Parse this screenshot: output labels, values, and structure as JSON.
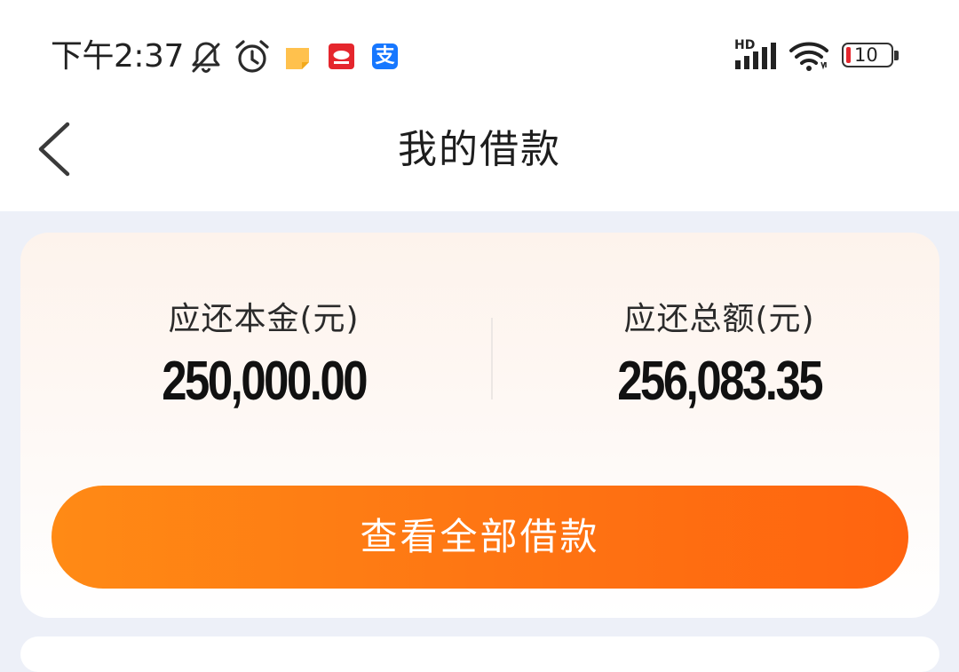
{
  "status_bar": {
    "time": "下午2:37",
    "hd_label": "HD",
    "battery_level": "10",
    "alipay_glyph": "支",
    "icons": [
      "bell-off-icon",
      "alarm-icon",
      "notes-app-icon",
      "red-app-icon",
      "alipay-icon",
      "signal-icon",
      "wifi-icon",
      "battery-icon"
    ]
  },
  "nav": {
    "title": "我的借款",
    "back_icon": "chevron-left-icon"
  },
  "summary": {
    "principal_label": "应还本金(元)",
    "principal_value": "250,000.00",
    "total_label": "应还总额(元)",
    "total_value": "256,083.35"
  },
  "actions": {
    "view_all_label": "查看全部借款"
  },
  "colors": {
    "accent_start": "#ff8a15",
    "accent_end": "#ff640f",
    "page_bg": "#edf0f8",
    "battery_low": "#e5262d"
  }
}
